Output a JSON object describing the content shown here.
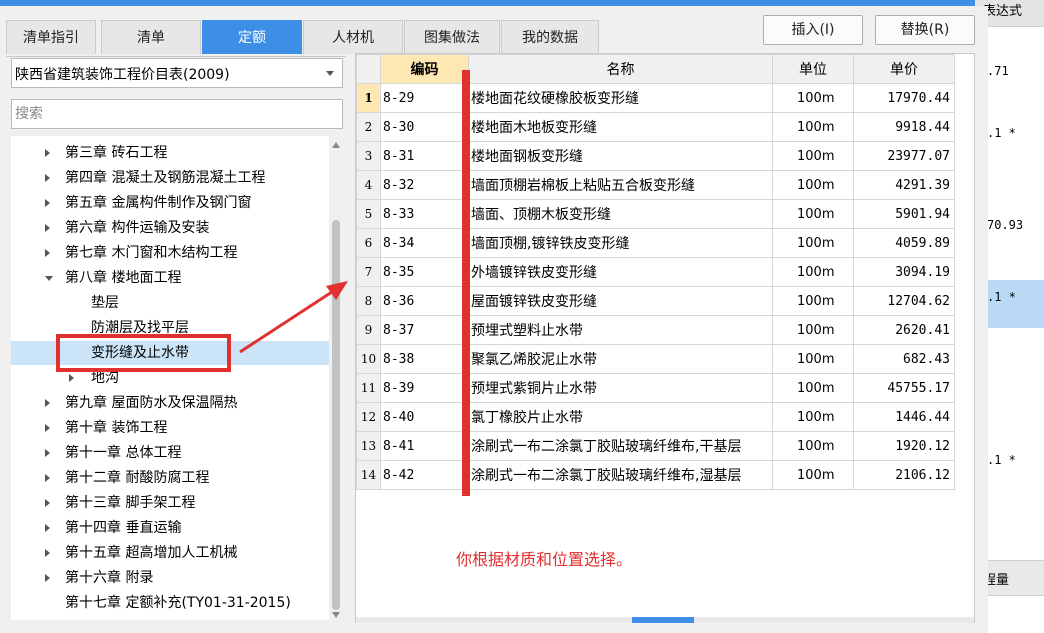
{
  "tabs": [
    {
      "label": "清单指引",
      "active": false
    },
    {
      "label": "清单",
      "active": false
    },
    {
      "label": "定额",
      "active": true
    },
    {
      "label": "人材机",
      "active": false
    },
    {
      "label": "图集做法",
      "active": false
    },
    {
      "label": "我的数据",
      "active": false
    }
  ],
  "buttons": {
    "insert": "插入(I)",
    "replace": "替换(R)"
  },
  "library_select": {
    "value": "陕西省建筑装饰工程价目表(2009)"
  },
  "search": {
    "placeholder": "搜索",
    "value": ""
  },
  "tree": [
    {
      "label": "第三章 砖石工程",
      "indent": 0,
      "expand": "closed"
    },
    {
      "label": "第四章 混凝土及钢筋混凝土工程",
      "indent": 0,
      "expand": "closed"
    },
    {
      "label": "第五章 金属构件制作及钢门窗",
      "indent": 0,
      "expand": "closed"
    },
    {
      "label": "第六章 构件运输及安装",
      "indent": 0,
      "expand": "closed"
    },
    {
      "label": "第七章 木门窗和木结构工程",
      "indent": 0,
      "expand": "closed"
    },
    {
      "label": "第八章 楼地面工程",
      "indent": 0,
      "expand": "open"
    },
    {
      "label": "垫层",
      "indent": 1,
      "expand": "none"
    },
    {
      "label": "防潮层及找平层",
      "indent": 1,
      "expand": "none"
    },
    {
      "label": "变形缝及止水带",
      "indent": 1,
      "expand": "none",
      "selected": true
    },
    {
      "label": "地沟",
      "indent": 1,
      "expand": "closed"
    },
    {
      "label": "第九章 屋面防水及保温隔热",
      "indent": 0,
      "expand": "closed"
    },
    {
      "label": "第十章 装饰工程",
      "indent": 0,
      "expand": "closed"
    },
    {
      "label": "第十一章 总体工程",
      "indent": 0,
      "expand": "closed"
    },
    {
      "label": "第十二章 耐酸防腐工程",
      "indent": 0,
      "expand": "closed"
    },
    {
      "label": "第十三章 脚手架工程",
      "indent": 0,
      "expand": "closed"
    },
    {
      "label": "第十四章 垂直运输",
      "indent": 0,
      "expand": "closed"
    },
    {
      "label": "第十五章 超高增加人工机械",
      "indent": 0,
      "expand": "closed"
    },
    {
      "label": "第十六章 附录",
      "indent": 0,
      "expand": "closed"
    },
    {
      "label": "第十七章 定额补充(TY01-31-2015)",
      "indent": 0,
      "expand": "none"
    }
  ],
  "table": {
    "headers": {
      "code": "编码",
      "name": "名称",
      "unit": "单位",
      "price": "单价"
    },
    "rows": [
      {
        "idx": "1",
        "code": "8-29",
        "name": "楼地面花纹硬橡胶板变形缝",
        "unit": "100m",
        "price": "17970.44"
      },
      {
        "idx": "2",
        "code": "8-30",
        "name": "楼地面木地板变形缝",
        "unit": "100m",
        "price": "9918.44"
      },
      {
        "idx": "3",
        "code": "8-31",
        "name": "楼地面钢板变形缝",
        "unit": "100m",
        "price": "23977.07"
      },
      {
        "idx": "4",
        "code": "8-32",
        "name": "墙面顶棚岩棉板上粘贴五合板变形缝",
        "unit": "100m",
        "price": "4291.39"
      },
      {
        "idx": "5",
        "code": "8-33",
        "name": "墙面、顶棚木板变形缝",
        "unit": "100m",
        "price": "5901.94"
      },
      {
        "idx": "6",
        "code": "8-34",
        "name": "墙面顶棚,镀锌铁皮变形缝",
        "unit": "100m",
        "price": "4059.89"
      },
      {
        "idx": "7",
        "code": "8-35",
        "name": "外墙镀锌铁皮变形缝",
        "unit": "100m",
        "price": "3094.19"
      },
      {
        "idx": "8",
        "code": "8-36",
        "name": "屋面镀锌铁皮变形缝",
        "unit": "100m",
        "price": "12704.62"
      },
      {
        "idx": "9",
        "code": "8-37",
        "name": "预埋式塑料止水带",
        "unit": "100m",
        "price": "2620.41"
      },
      {
        "idx": "10",
        "code": "8-38",
        "name": "聚氯乙烯胶泥止水带",
        "unit": "100m",
        "price": "682.43"
      },
      {
        "idx": "11",
        "code": "8-39",
        "name": "预埋式紫铜片止水带",
        "unit": "100m",
        "price": "45755.17"
      },
      {
        "idx": "12",
        "code": "8-40",
        "name": "氯丁橡胶片止水带",
        "unit": "100m",
        "price": "1446.44"
      },
      {
        "idx": "13",
        "code": "8-41",
        "name": "涂刷式一布二涂氯丁胶贴玻璃纤维布,干基层",
        "unit": "100m",
        "price": "1920.12"
      },
      {
        "idx": "14",
        "code": "8-42",
        "name": "涂刷式一布二涂氯丁胶贴玻璃纤维布,湿基层",
        "unit": "100m",
        "price": "2106.12"
      }
    ]
  },
  "annotation": {
    "note": "你根据材质和位置选择。",
    "color": "#e03030"
  },
  "background_panel": {
    "header": "表达式",
    "cells": [
      ".71",
      ".1 *",
      "70.93",
      ".1 *",
      ".1 *"
    ],
    "button": "程量"
  },
  "colors": {
    "accent": "#3d8ee6",
    "selection": "#cce4f7",
    "header_highlight": "#fde7b3"
  }
}
